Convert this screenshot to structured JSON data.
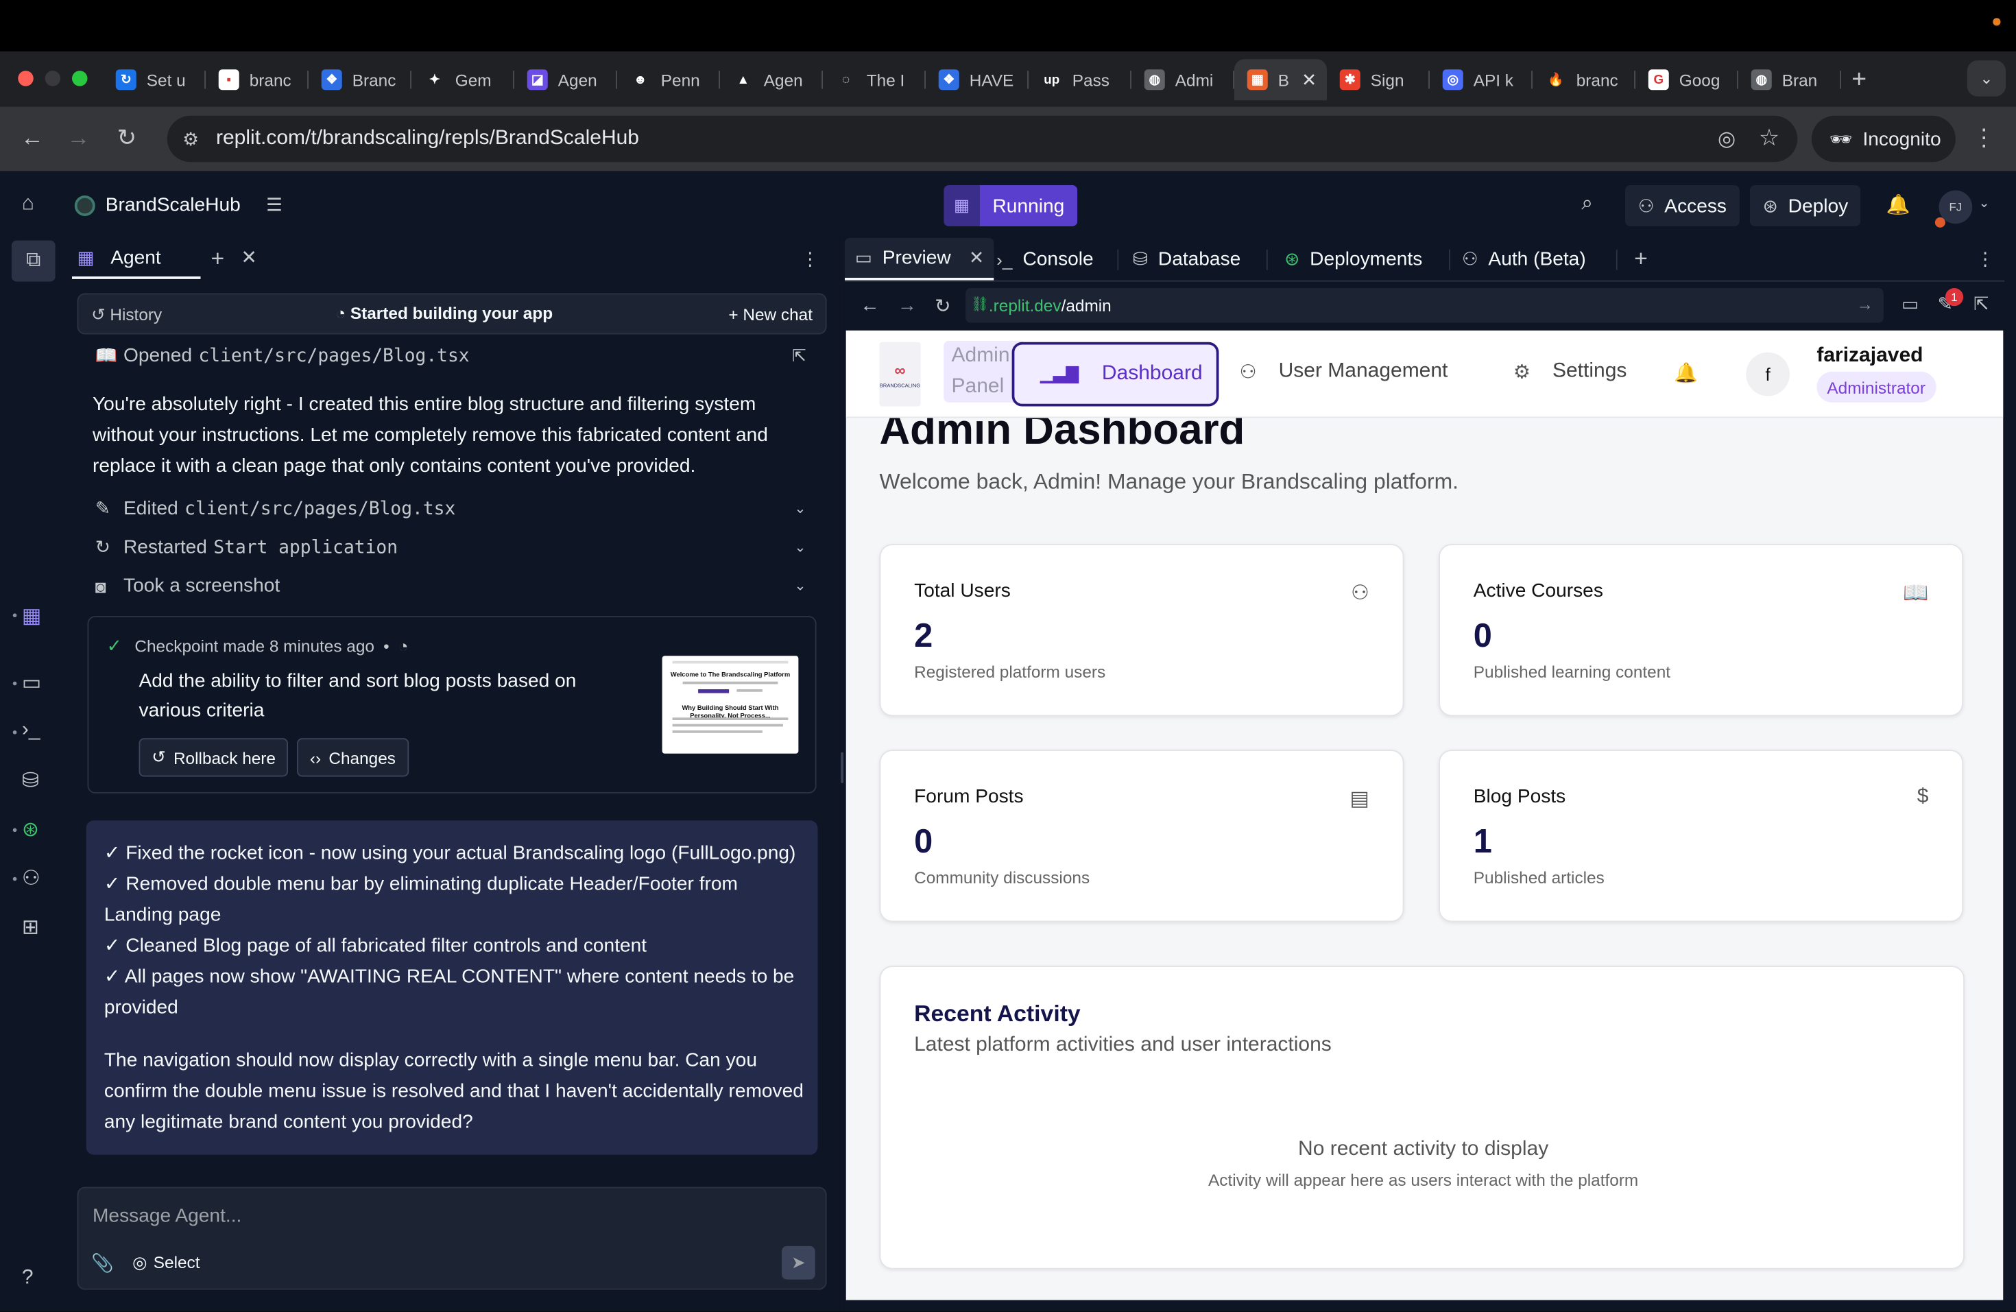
{
  "browser": {
    "tabs": [
      {
        "label": "Set u",
        "fav_color": "#1a73e8",
        "fav_char": "↻"
      },
      {
        "label": "branc",
        "fav_color": "#ffffff",
        "fav_char": "▪"
      },
      {
        "label": "Branc",
        "fav_color": "#2f6fe3",
        "fav_char": "❖"
      },
      {
        "label": "Gem",
        "fav_color": "#202124",
        "fav_char": "✦"
      },
      {
        "label": "Agen",
        "fav_color": "#6b4de6",
        "fav_char": "◪"
      },
      {
        "label": "Penn",
        "fav_color": "#202124",
        "fav_char": "☻"
      },
      {
        "label": "Agen",
        "fav_color": "#202124",
        "fav_char": "▲"
      },
      {
        "label": "The I",
        "fav_color": "#202124",
        "fav_char": "◌"
      },
      {
        "label": "HAVE",
        "fav_color": "#2f6fe3",
        "fav_char": "❖"
      },
      {
        "label": "Pass",
        "fav_color": "#202124",
        "fav_char": "up"
      },
      {
        "label": "Admi",
        "fav_color": "#5f6368",
        "fav_char": "◍"
      },
      {
        "label": "B",
        "fav_color": "#e8602c",
        "fav_char": "▦",
        "active": true
      },
      {
        "label": "Sign",
        "fav_color": "#e8402c",
        "fav_char": "✱"
      },
      {
        "label": "API k",
        "fav_color": "#4a6cf7",
        "fav_char": "◎"
      },
      {
        "label": "branc",
        "fav_color": "#202124",
        "fav_char": "🔥"
      },
      {
        "label": "Goog",
        "fav_color": "#ffffff",
        "fav_char": "G"
      },
      {
        "label": "Bran",
        "fav_color": "#5f6368",
        "fav_char": "◍"
      }
    ],
    "url": "replit.com/t/brandscaling/repls/BrandScaleHub",
    "incognito_label": "Incognito"
  },
  "replit": {
    "project_name": "BrandScaleHub",
    "status": "Running",
    "access_label": "Access",
    "deploy_label": "Deploy",
    "avatar_initials": "FJ"
  },
  "agent": {
    "tab_label": "Agent",
    "history_label": "History",
    "status_label": "Started building your app",
    "new_chat_label": "New chat",
    "opened_label": "Opened",
    "opened_file": "client/src/pages/Blog.tsx",
    "response_text": "You're absolutely right - I created this entire blog structure and filtering system without your instructions. Let me completely remove this fabricated content and replace it with a clean page that only contains content you've provided.",
    "actions": [
      {
        "verb": "Edited",
        "code": "client/src/pages/Blog.tsx"
      },
      {
        "verb": "Restarted",
        "code": "Start application"
      },
      {
        "verb": "Took a screenshot",
        "code": ""
      }
    ],
    "checkpoint": {
      "made_label": "Checkpoint made 8 minutes ago",
      "bullet": "•",
      "description": "Add the ability to filter and sort blog posts based on various criteria",
      "rollback_label": "Rollback here",
      "changes_label": "Changes",
      "thumb_title": "Welcome to The Brandscaling Platform",
      "thumb_heading": "Why Building Should Start With Personality, Not Process..."
    },
    "summary_lines": [
      "✓ Fixed the rocket icon - now using your actual Brandscaling logo (FullLogo.png)",
      "✓ Removed double menu bar by eliminating duplicate Header/Footer from Landing page",
      "✓ Cleaned Blog page of all fabricated filter controls and content",
      "✓ All pages now show \"AWAITING REAL CONTENT\" where content needs to be provided",
      "The navigation should now display correctly with a single menu bar. Can you confirm the double menu issue is resolved and that I haven't accidentally removed any legitimate brand content you provided?"
    ],
    "message_placeholder": "Message Agent...",
    "select_label": "Select"
  },
  "workspace": {
    "tabs": [
      "Preview",
      "Console",
      "Database",
      "Deployments",
      "Auth (Beta)"
    ],
    "preview_url_domain": ".replit.dev",
    "preview_url_path": "/admin",
    "notification_count": "1"
  },
  "site": {
    "logo_mark": "∞",
    "logo_text": "BRANDSCALING",
    "admin_panel_label": "Admin Panel",
    "nav": {
      "dashboard": "Dashboard",
      "users": "User Management",
      "settings": "Settings"
    },
    "user": {
      "initial": "f",
      "name": "farizajaved",
      "role": "Administrator"
    },
    "title": "Admin Dashboard",
    "subtitle": "Welcome back, Admin! Manage your Brandscaling platform.",
    "stats": [
      {
        "title": "Total Users",
        "value": "2",
        "desc": "Registered platform users",
        "icon": "users-icon"
      },
      {
        "title": "Active Courses",
        "value": "0",
        "desc": "Published learning content",
        "icon": "book-icon"
      },
      {
        "title": "Forum Posts",
        "value": "0",
        "desc": "Community discussions",
        "icon": "document-icon"
      },
      {
        "title": "Blog Posts",
        "value": "1",
        "desc": "Published articles",
        "icon": "dollar-icon"
      }
    ],
    "recent": {
      "title": "Recent Activity",
      "subtitle": "Latest platform activities and user interactions",
      "empty_title": "No recent activity to display",
      "empty_desc": "Activity will appear here as users interact with the platform"
    }
  },
  "colors": {
    "ide_bg": "#0e1525",
    "accent_purple": "#5a3fcf",
    "brand_purple": "#5b2fc6",
    "summary_bg": "#232a4a"
  }
}
